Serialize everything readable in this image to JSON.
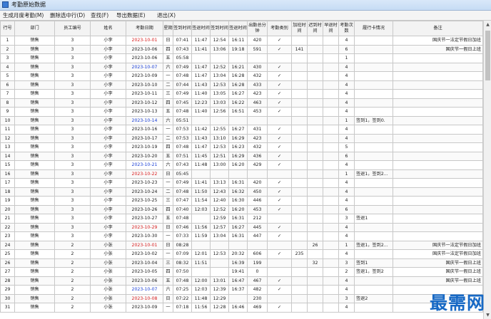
{
  "window": {
    "title": "考勤原始数据"
  },
  "menu": [
    "生成月度考勤(M)",
    "删除选中行(D)",
    "查找(F)",
    "导出数据(E)",
    "退出(X)"
  ],
  "columns": [
    "行号",
    "部门",
    "员工编号",
    "姓名",
    "考勤日期",
    "星期",
    "签到时间",
    "签退时间",
    "签到时间",
    "签退时间",
    "出勤总分钟",
    "考勤类别",
    "加班时间",
    "迟到时间",
    "早退时间",
    "考勤次数",
    "履行卡情况",
    "备注"
  ],
  "date_colors": {
    "weekday": "#222222",
    "sunday": "#d81e1e",
    "saturday": "#1a3fd6"
  },
  "rows": [
    [
      "1",
      "销售",
      "3",
      "小李",
      "2023-10-01",
      "日",
      "07:41",
      "11:47",
      "12:54",
      "16:11",
      "420",
      "✓",
      "",
      "",
      "",
      "4",
      "",
      "国庆节一法定节假日加班"
    ],
    [
      "2",
      "销售",
      "3",
      "小李",
      "2023-10-06",
      "四",
      "07:43",
      "11:41",
      "13:06",
      "19:18",
      "591",
      "✓",
      "141",
      "",
      "",
      "6",
      "",
      "国庆节一假日上班"
    ],
    [
      "3",
      "销售",
      "3",
      "小李",
      "2023-10-06",
      "五",
      "05:58",
      "",
      "",
      "",
      "",
      "",
      "",
      "",
      "",
      "1",
      "",
      ""
    ],
    [
      "4",
      "销售",
      "3",
      "小李",
      "2023-10-07",
      "六",
      "07:49",
      "11:47",
      "12:52",
      "16:21",
      "430",
      "✓",
      "",
      "",
      "",
      "4",
      "",
      ""
    ],
    [
      "5",
      "销售",
      "3",
      "小李",
      "2023-10-09",
      "一",
      "07:48",
      "11:47",
      "13:04",
      "16:28",
      "432",
      "✓",
      "",
      "",
      "",
      "4",
      "",
      ""
    ],
    [
      "6",
      "销售",
      "3",
      "小李",
      "2023-10-10",
      "二",
      "07:44",
      "11:43",
      "12:53",
      "16:28",
      "433",
      "✓",
      "",
      "",
      "",
      "4",
      "",
      ""
    ],
    [
      "7",
      "销售",
      "3",
      "小李",
      "2023-10-11",
      "三",
      "07:49",
      "11:40",
      "13:05",
      "16:27",
      "423",
      "✓",
      "",
      "",
      "",
      "4",
      "",
      ""
    ],
    [
      "8",
      "销售",
      "3",
      "小李",
      "2023-10-12",
      "四",
      "07:45",
      "12:23",
      "13:03",
      "16:22",
      "463",
      "✓",
      "",
      "",
      "",
      "4",
      "",
      ""
    ],
    [
      "9",
      "销售",
      "3",
      "小李",
      "2023-10-13",
      "五",
      "07:48",
      "11:40",
      "12:56",
      "16:51",
      "453",
      "✓",
      "",
      "",
      "",
      "4",
      "",
      ""
    ],
    [
      "10",
      "销售",
      "3",
      "小李",
      "2023-10-14",
      "六",
      "05:51",
      "",
      "",
      "",
      "",
      "",
      "",
      "",
      "",
      "1",
      "签到1，签到0.",
      ""
    ],
    [
      "11",
      "销售",
      "3",
      "小李",
      "2023-10-16",
      "一",
      "07:53",
      "11:42",
      "12:55",
      "16:27",
      "431",
      "✓",
      "",
      "",
      "",
      "4",
      "",
      ""
    ],
    [
      "12",
      "销售",
      "3",
      "小李",
      "2023-10-17",
      "二",
      "07:53",
      "11:43",
      "13:10",
      "16:29",
      "423",
      "✓",
      "",
      "",
      "",
      "4",
      "",
      ""
    ],
    [
      "13",
      "销售",
      "3",
      "小李",
      "2023-10-19",
      "四",
      "07:48",
      "11:47",
      "12:53",
      "16:23",
      "432",
      "✓",
      "",
      "",
      "",
      "5",
      "",
      ""
    ],
    [
      "14",
      "销售",
      "3",
      "小李",
      "2023-10-20",
      "五",
      "07:51",
      "11:45",
      "12:51",
      "16:29",
      "436",
      "✓",
      "",
      "",
      "",
      "6",
      "",
      ""
    ],
    [
      "15",
      "销售",
      "3",
      "小李",
      "2023-10-21",
      "六",
      "07:43",
      "11:48",
      "13:00",
      "16:20",
      "429",
      "✓",
      "",
      "",
      "",
      "4",
      "",
      ""
    ],
    [
      "16",
      "销售",
      "3",
      "小李",
      "2023-10-22",
      "日",
      "05:45",
      "",
      "",
      "",
      "",
      "",
      "",
      "",
      "",
      "1",
      "签退1，签到2...",
      ""
    ],
    [
      "17",
      "销售",
      "3",
      "小李",
      "2023-10-23",
      "一",
      "07:49",
      "11:41",
      "13:13",
      "16:31",
      "420",
      "✓",
      "",
      "",
      "",
      "4",
      "",
      ""
    ],
    [
      "18",
      "销售",
      "3",
      "小李",
      "2023-10-24",
      "二",
      "07:48",
      "11:50",
      "12:43",
      "16:32",
      "450",
      "✓",
      "",
      "",
      "",
      "4",
      "",
      ""
    ],
    [
      "19",
      "销售",
      "3",
      "小李",
      "2023-10-25",
      "三",
      "07:47",
      "11:54",
      "12:40",
      "16:30",
      "446",
      "✓",
      "",
      "",
      "",
      "4",
      "",
      ""
    ],
    [
      "20",
      "销售",
      "3",
      "小李",
      "2023-10-26",
      "四",
      "07:40",
      "12:03",
      "12:52",
      "16:20",
      "453",
      "✓",
      "",
      "",
      "",
      "6",
      "",
      ""
    ],
    [
      "21",
      "销售",
      "3",
      "小李",
      "2023-10-27",
      "五",
      "07:48",
      "",
      "12:59",
      "16:31",
      "212",
      "",
      "",
      "",
      "",
      "3",
      "签退1",
      ""
    ],
    [
      "22",
      "销售",
      "3",
      "小李",
      "2023-10-29",
      "日",
      "07:46",
      "11:56",
      "12:57",
      "16:27",
      "445",
      "✓",
      "",
      "",
      "",
      "4",
      "",
      ""
    ],
    [
      "23",
      "销售",
      "3",
      "小李",
      "2023-10-30",
      "一",
      "07:33",
      "11:59",
      "13:04",
      "16:31",
      "447",
      "✓",
      "",
      "",
      "",
      "4",
      "",
      ""
    ],
    [
      "24",
      "销售",
      "2",
      "小张",
      "2023-10-01",
      "日",
      "08:28",
      "",
      "",
      "",
      "",
      "",
      "",
      "26",
      "",
      "1",
      "签退1，签到2...",
      "国庆节一法定节假日加班"
    ],
    [
      "25",
      "销售",
      "2",
      "小张",
      "2023-10-02",
      "一",
      "07:09",
      "12:01",
      "12:53",
      "20:32",
      "606",
      "✓",
      "235",
      "",
      "",
      "4",
      "",
      "国庆节一法定节假日加班"
    ],
    [
      "26",
      "销售",
      "2",
      "小张",
      "2023-10-04",
      "三",
      "08:32",
      "11:51",
      "",
      "16:39",
      "199",
      "",
      "",
      "32",
      "",
      "3",
      "签到1",
      "国庆节一假日上班"
    ],
    [
      "27",
      "销售",
      "2",
      "小张",
      "2023-10-05",
      "四",
      "07:50",
      "",
      "",
      "19:41",
      "0",
      "",
      "",
      "",
      "",
      "2",
      "签退1，签到2",
      "国庆节一假日上班"
    ],
    [
      "28",
      "销售",
      "2",
      "小张",
      "2023-10-06",
      "五",
      "07:48",
      "12:00",
      "13:01",
      "16:47",
      "467",
      "✓",
      "",
      "",
      "",
      "4",
      "",
      "国庆节一假日上班"
    ],
    [
      "29",
      "销售",
      "2",
      "小张",
      "2023-10-07",
      "六",
      "07:25",
      "12:03",
      "12:39",
      "16:37",
      "482",
      "✓",
      "",
      "",
      "",
      "4",
      "",
      ""
    ],
    [
      "30",
      "销售",
      "2",
      "小张",
      "2023-10-08",
      "日",
      "07:22",
      "11:48",
      "12:29",
      "",
      "230",
      "",
      "",
      "",
      "",
      "3",
      "签退2",
      ""
    ],
    [
      "31",
      "销售",
      "2",
      "小张",
      "2023-10-09",
      "一",
      "07:18",
      "11:56",
      "12:28",
      "16:46",
      "469",
      "✓",
      "",
      "",
      "",
      "4",
      "",
      ""
    ]
  ],
  "watermark": "最需网"
}
